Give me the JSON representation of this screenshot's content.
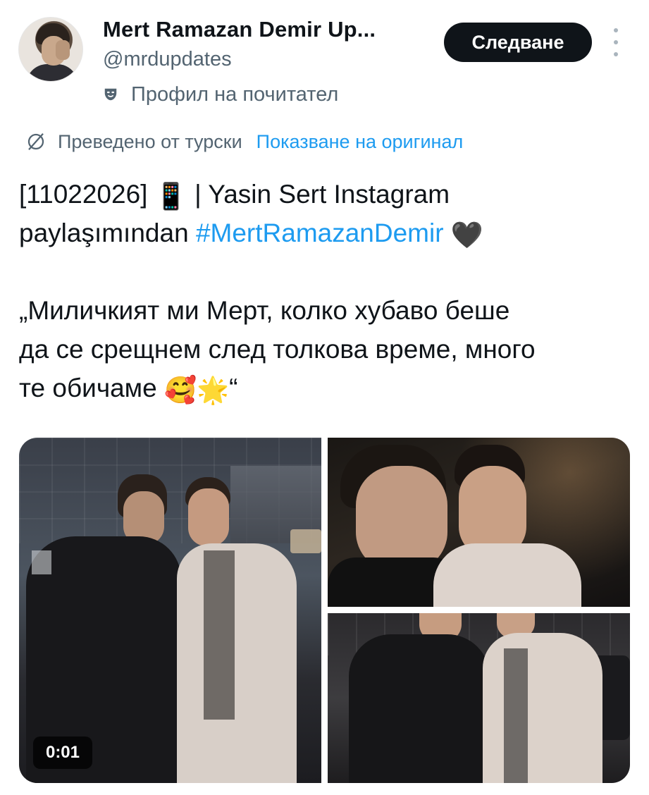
{
  "author": {
    "display_name": "Mert Ramazan Demir Up...",
    "handle": "@mrdupdates",
    "avatar_icon": "avatar",
    "fan_icon": "theater-mask-icon",
    "fan_label": "Профил на почитател"
  },
  "actions": {
    "follow_label": "Следване",
    "more_icon": "more-vertical-icon"
  },
  "translation": {
    "icon": "globe-slash-icon",
    "translated_label": "Преведено от турски",
    "show_original_label": "Показване на оригинал"
  },
  "tweet": {
    "line1_prefix": "[11022026] ",
    "line1_emoji": "📱",
    "line1_suffix": " | Yasin Sert Instagram",
    "line2_text": "paylaşımından ",
    "hashtag": "#MertRamazanDemir",
    "line2_emoji": "🖤",
    "quote_line1": "„Миличкият ми Мерт, колко хубаво беше",
    "quote_line2": "да се срещнем след толкова време, много",
    "quote_line3_text": "те обичаме ",
    "quote_line3_emoji1": "🥰",
    "quote_line3_emoji2": "🌟",
    "quote_line3_end": "“"
  },
  "media": {
    "video_duration": "0:01",
    "images": [
      "video-thumbnail",
      "photo-selfie",
      "photo-standing"
    ]
  },
  "colors": {
    "link": "#1d9bf0",
    "secondary_text": "#536471",
    "primary_text": "#0f1419",
    "button_bg": "#0f1419"
  }
}
